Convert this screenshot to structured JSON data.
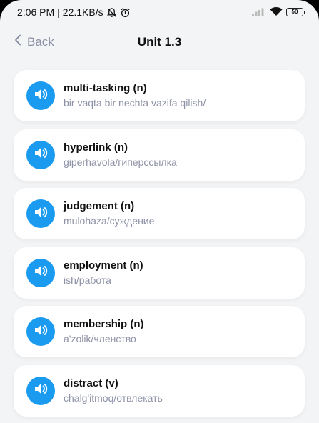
{
  "status_bar": {
    "time": "2:06 PM",
    "speed": "22.1KB/s",
    "battery": "50",
    "icons": [
      "mute-icon",
      "alarm-icon",
      "signal-icon",
      "wifi-icon",
      "battery-icon"
    ]
  },
  "header": {
    "back_label": "Back",
    "title": "Unit 1.3"
  },
  "words": [
    {
      "term": "multi-tasking (n)",
      "translation": "bir vaqta bir nechta vazifa qilish/"
    },
    {
      "term": "hyperlink (n)",
      "translation": "giperhavola/гиперссылка"
    },
    {
      "term": "judgement (n)",
      "translation": "mulohaza/суждение"
    },
    {
      "term": "employment (n)",
      "translation": "ish/работа"
    },
    {
      "term": "membership (n)",
      "translation": "a'zolik/членство"
    },
    {
      "term": "distract (v)",
      "translation": "chalg'itmoq/отвлекать"
    }
  ],
  "colors": {
    "accent": "#1a9bf0",
    "background": "#f3f4f6",
    "card": "#ffffff",
    "muted_text": "#8e92a6"
  }
}
